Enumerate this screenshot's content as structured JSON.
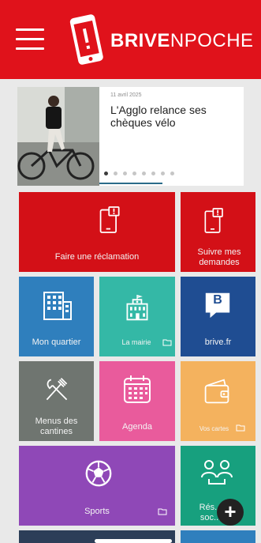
{
  "header": {
    "brand_bold": "BRIVE",
    "brand_light": "NPOCHE",
    "bg_color": "#e0121b"
  },
  "news": {
    "date": "11 avril 2025",
    "title": "L'Agglo relance ses chèques vélo",
    "slide_count": 8,
    "active_slide": 1
  },
  "tiles": {
    "reclamation": "Faire une réclamation",
    "suivre": "Suivre mes demandes",
    "quartier": "Mon quartier",
    "mairie": "La mairie",
    "brive": "brive.fr",
    "brive_letter": "B",
    "menus": "Menus des cantines",
    "agenda": "Agenda",
    "cartes": "Vos cartes",
    "sports": "Sports",
    "reseaux": "Rés... soc..."
  },
  "colors": {
    "red": "#d31017",
    "blue": "#2f7fbd",
    "teal": "#34b8a6",
    "navy": "#1f4d92",
    "gray": "#6f7570",
    "pink": "#e95b9c",
    "orange": "#f4b25e",
    "purple": "#8f48b7",
    "green": "#17a07e"
  },
  "fab": {
    "symbol": "+"
  }
}
